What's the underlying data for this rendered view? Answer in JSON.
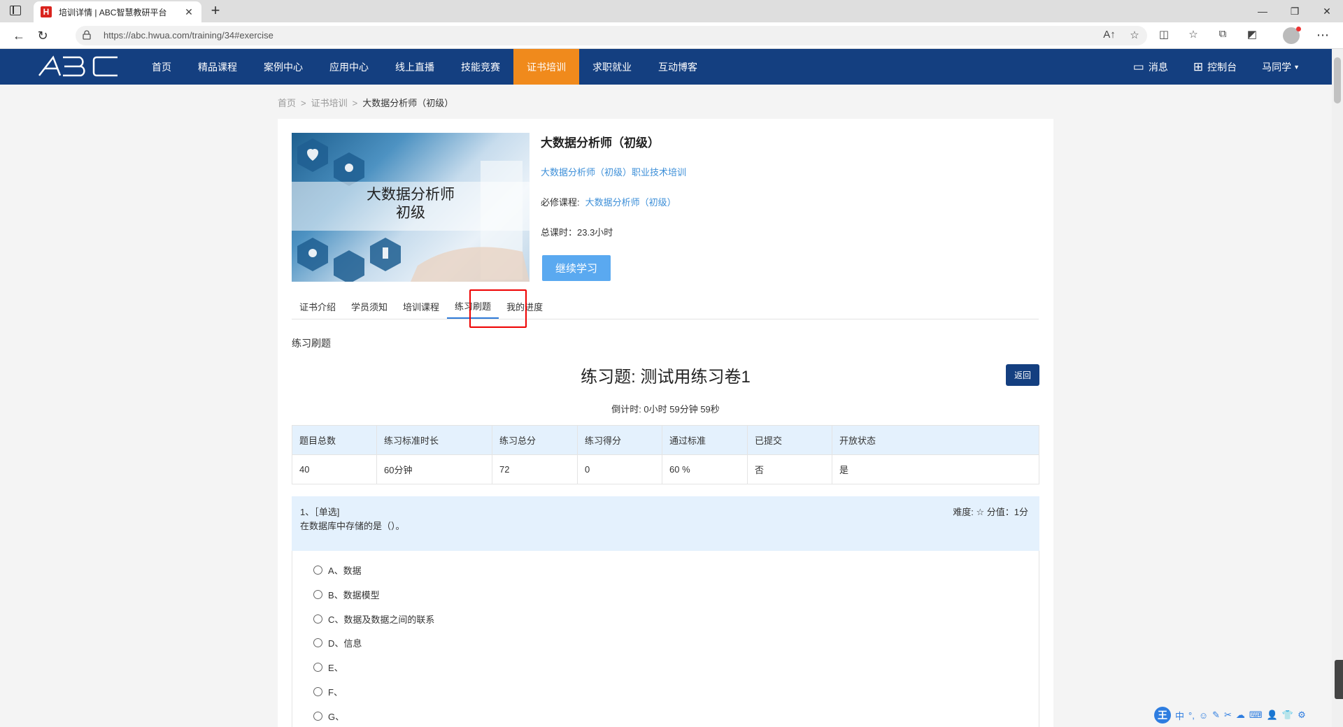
{
  "browser": {
    "tab_title": "培训详情 | ABC智慧教研平台",
    "tab_favicon": "H",
    "url": "https://abc.hwua.com/training/34#exercise"
  },
  "nav": {
    "logo": "ABC",
    "items": [
      "首页",
      "精品课程",
      "案例中心",
      "应用中心",
      "线上直播",
      "技能竞赛",
      "证书培训",
      "求职就业",
      "互动博客"
    ],
    "active_index": 6,
    "messages": "消息",
    "console": "控制台",
    "user": "马同学"
  },
  "breadcrumb": {
    "home": "首页",
    "parent": "证书培训",
    "current": "大数据分析师（初级）"
  },
  "course": {
    "cover_title": "大数据分析师",
    "cover_sub": "初级",
    "title": "大数据分析师（初级）",
    "subtitle": "大数据分析师（初级）职业技术培训",
    "required_label": "必修课程:",
    "required_value": "大数据分析师（初级）",
    "hours": "总课时：23.3小时",
    "continue_label": "继续学习"
  },
  "tabs": [
    "证书介绍",
    "学员须知",
    "培训课程",
    "练习刷题",
    "我的进度"
  ],
  "active_tab": 3,
  "exercise": {
    "section_label": "练习刷题",
    "title": "练习题: 测试用练习卷1",
    "back_label": "返回",
    "countdown": "倒计时:  0小时 59分钟 59秒",
    "stats_headers": [
      "题目总数",
      "练习标准时长",
      "练习总分",
      "练习得分",
      "通过标准",
      "已提交",
      "开放状态"
    ],
    "stats_values": [
      "40",
      "60分钟",
      "72",
      "0",
      "60 %",
      "否",
      "是"
    ]
  },
  "question": {
    "type": "1、［单选]",
    "text": "在数据库中存储的是（）。",
    "meta": "难度:  ☆  分值：1分",
    "options": [
      "A、数据",
      "B、数据模型",
      "C、数据及数据之间的联系",
      "D、信息",
      "E、",
      "F、",
      "G、"
    ]
  },
  "colors": {
    "nav_bg": "#143f80",
    "active_nav": "#f08a1c",
    "link": "#3d8fd8",
    "header_row": "#e4f1fd",
    "highlight": "#e00000"
  },
  "ime": {
    "logo": "王",
    "items": [
      "中",
      "°,",
      "☺",
      "✎",
      "✂",
      "☁",
      "⌨",
      "👤",
      "👕",
      "⚙"
    ]
  }
}
